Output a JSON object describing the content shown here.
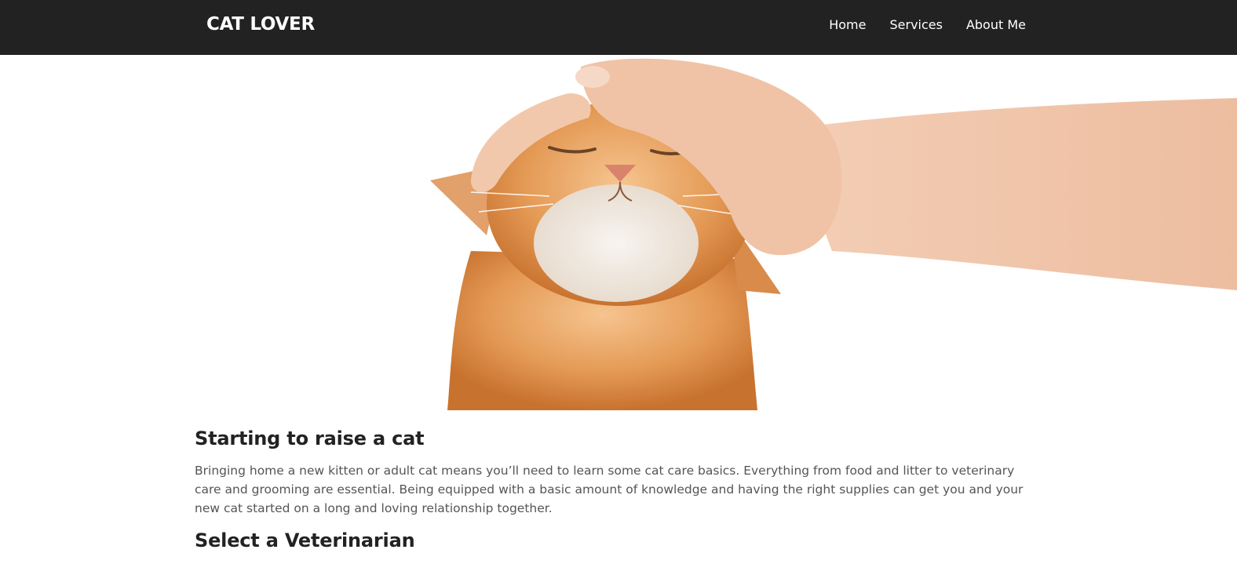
{
  "navbar": {
    "brand": "CAT LOVER",
    "links": [
      "Home",
      "Services",
      "About Me"
    ]
  },
  "hero": {
    "image_alt": "orange-cat-being-petted-photo"
  },
  "content": {
    "sections": [
      {
        "heading": "Starting to raise a cat",
        "text": "Bringing home a new kitten or adult cat means you’ll need to learn some cat care basics. Everything from food and litter to veterinary care and grooming are essential. Being equipped with a basic amount of knowledge and having the right supplies can get you and your new cat started on a long and loving relationship together."
      },
      {
        "heading": "Select a Veterinarian"
      }
    ]
  },
  "colors": {
    "navbar_bg": "#222222",
    "nav_text": "#ffffff",
    "heading": "#222222",
    "body_text": "#555555",
    "cat_fur": "#E39A55",
    "skin": "#F2C6A8"
  }
}
